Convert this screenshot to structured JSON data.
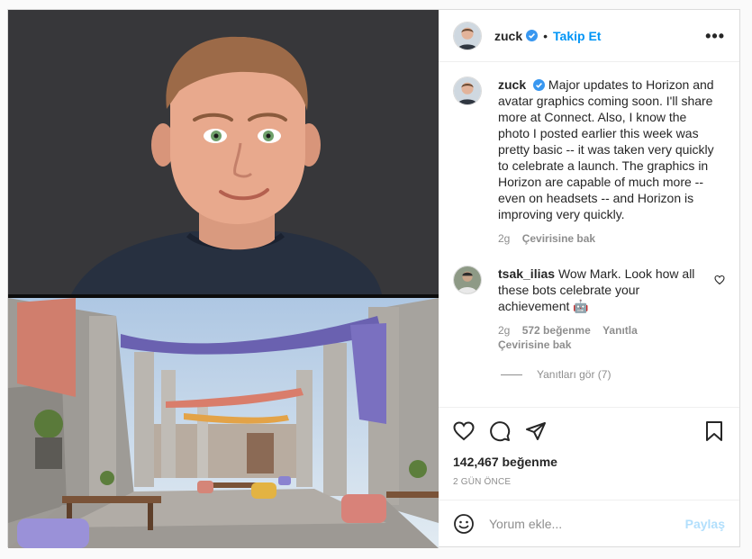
{
  "header": {
    "username": "zuck",
    "follow_label": "Takip Et",
    "more_label": "•••"
  },
  "caption": {
    "username": "zuck",
    "text": "Major updates to Horizon and avatar graphics coming soon. I'll share more at Connect. Also, I know the photo I posted earlier this week was pretty basic -- it was taken very quickly to celebrate a launch. The graphics in Horizon are capable of much more -- even on headsets -- and Horizon is improving very quickly.",
    "time": "2g",
    "translate": "Çevirisine bak"
  },
  "comments": [
    {
      "username": "tsak_ilias",
      "text": "Wow Mark. Look how all these bots celebrate your achievement 🤖",
      "time": "2g",
      "likes": "572 beğenme",
      "reply": "Yanıtla",
      "translate": "Çevirisine bak",
      "view_replies": "Yanıtları gör (7)"
    }
  ],
  "post": {
    "likes": "142,467 beğenme",
    "time": "2 GÜN ÖNCE"
  },
  "comment_box": {
    "placeholder": "Yorum ekle...",
    "post_label": "Paylaş"
  },
  "icons": {
    "verified": "verified-badge-icon",
    "like": "heart-icon",
    "comment": "comment-bubble-icon",
    "share": "paper-plane-icon",
    "save": "bookmark-icon",
    "emoji": "smiley-icon"
  },
  "colors": {
    "accent": "#0095f6",
    "post_disabled": "#b2dffc",
    "muted": "#8e8e8e",
    "text": "#262626"
  }
}
